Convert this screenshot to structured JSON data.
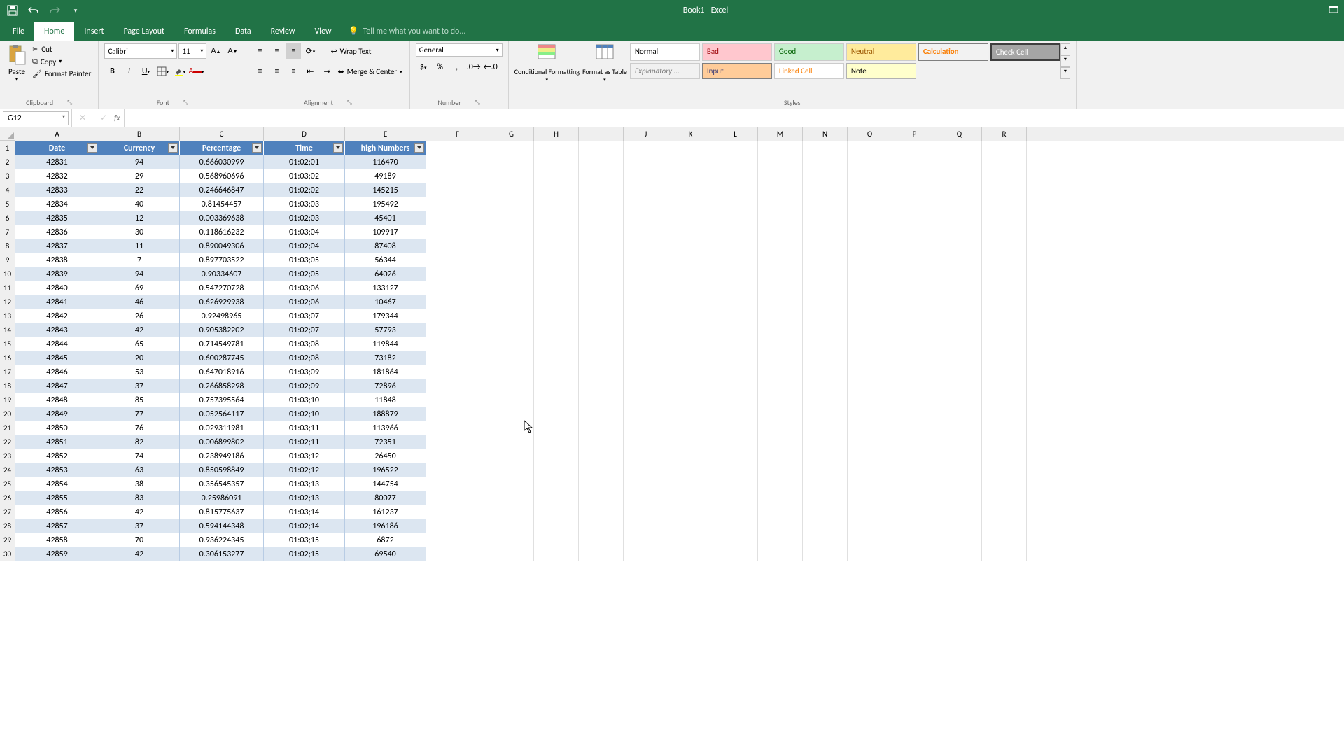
{
  "title": "Book1 - Excel",
  "qat": {
    "save": "save-icon",
    "undo": "undo-icon",
    "redo": "redo-icon"
  },
  "tabs": [
    "File",
    "Home",
    "Insert",
    "Page Layout",
    "Formulas",
    "Data",
    "Review",
    "View"
  ],
  "active_tab": 1,
  "tell_me": "Tell me what you want to do...",
  "ribbon": {
    "clipboard": {
      "label": "Clipboard",
      "paste": "Paste",
      "cut": "Cut",
      "copy": "Copy",
      "painter": "Format Painter"
    },
    "font": {
      "label": "Font",
      "name": "Calibri",
      "size": "11"
    },
    "alignment": {
      "label": "Alignment",
      "wrap": "Wrap Text",
      "merge": "Merge & Center"
    },
    "number": {
      "label": "Number",
      "format": "General"
    },
    "styles": {
      "label": "Styles",
      "cond": "Conditional Formatting",
      "table": "Format as Table",
      "gallery": [
        "Normal",
        "Bad",
        "Good",
        "Neutral",
        "Calculation",
        "Check Cell",
        "Explanatory ...",
        "Input",
        "Linked Cell",
        "Note"
      ]
    }
  },
  "name_box": "G12",
  "columns": [
    "A",
    "B",
    "C",
    "D",
    "E",
    "F",
    "G",
    "H",
    "I",
    "J",
    "K",
    "L",
    "M",
    "N",
    "O",
    "P",
    "Q",
    "R"
  ],
  "col_widths": [
    "cA",
    "cB",
    "cC",
    "cD",
    "cE",
    "cF",
    "cG",
    "cX",
    "cX",
    "cX",
    "cX",
    "cX",
    "cX",
    "cX",
    "cX",
    "cX",
    "cX",
    "cX"
  ],
  "table_headers": [
    "Date",
    "Currency",
    "Percentage",
    "Time",
    "high Numbers"
  ],
  "rows": [
    {
      "n": 2,
      "d": [
        42831,
        94,
        "0.666030999",
        "01:02;01",
        116470
      ]
    },
    {
      "n": 3,
      "d": [
        42832,
        29,
        "0.568960696",
        "01:03;02",
        49189
      ]
    },
    {
      "n": 4,
      "d": [
        42833,
        22,
        "0.246646847",
        "01:02;02",
        145215
      ]
    },
    {
      "n": 5,
      "d": [
        42834,
        40,
        "0.81454457",
        "01:03;03",
        195492
      ]
    },
    {
      "n": 6,
      "d": [
        42835,
        12,
        "0.003369638",
        "01:02;03",
        45401
      ]
    },
    {
      "n": 7,
      "d": [
        42836,
        30,
        "0.118616232",
        "01:03;04",
        109917
      ]
    },
    {
      "n": 8,
      "d": [
        42837,
        11,
        "0.890049306",
        "01:02;04",
        87408
      ]
    },
    {
      "n": 9,
      "d": [
        42838,
        7,
        "0.897703522",
        "01:03;05",
        56344
      ]
    },
    {
      "n": 10,
      "d": [
        42839,
        94,
        "0.90334607",
        "01:02;05",
        64026
      ]
    },
    {
      "n": 11,
      "d": [
        42840,
        69,
        "0.547270728",
        "01:03;06",
        133127
      ]
    },
    {
      "n": 12,
      "d": [
        42841,
        46,
        "0.626929938",
        "01:02;06",
        10467
      ]
    },
    {
      "n": 13,
      "d": [
        42842,
        26,
        "0.92498965",
        "01:03;07",
        179344
      ]
    },
    {
      "n": 14,
      "d": [
        42843,
        42,
        "0.905382202",
        "01:02;07",
        57793
      ]
    },
    {
      "n": 15,
      "d": [
        42844,
        65,
        "0.714549781",
        "01:03;08",
        119844
      ]
    },
    {
      "n": 16,
      "d": [
        42845,
        20,
        "0.600287745",
        "01:02;08",
        73182
      ]
    },
    {
      "n": 17,
      "d": [
        42846,
        53,
        "0.647018916",
        "01:03;09",
        181864
      ]
    },
    {
      "n": 18,
      "d": [
        42847,
        37,
        "0.266858298",
        "01:02;09",
        72896
      ]
    },
    {
      "n": 19,
      "d": [
        42848,
        85,
        "0.757395564",
        "01:03;10",
        11848
      ]
    },
    {
      "n": 20,
      "d": [
        42849,
        77,
        "0.052564117",
        "01:02;10",
        188879
      ]
    },
    {
      "n": 21,
      "d": [
        42850,
        76,
        "0.029311981",
        "01:03;11",
        113966
      ]
    },
    {
      "n": 22,
      "d": [
        42851,
        82,
        "0.006899802",
        "01:02;11",
        72351
      ]
    },
    {
      "n": 23,
      "d": [
        42852,
        74,
        "0.238949186",
        "01:03;12",
        26450
      ]
    },
    {
      "n": 24,
      "d": [
        42853,
        63,
        "0.850598849",
        "01:02;12",
        196522
      ]
    },
    {
      "n": 25,
      "d": [
        42854,
        38,
        "0.356545357",
        "01:03;13",
        144754
      ]
    },
    {
      "n": 26,
      "d": [
        42855,
        83,
        "0.25986091",
        "01:02;13",
        80077
      ]
    },
    {
      "n": 27,
      "d": [
        42856,
        42,
        "0.815775637",
        "01:03;14",
        161237
      ]
    },
    {
      "n": 28,
      "d": [
        42857,
        37,
        "0.594144348",
        "01:02;14",
        196186
      ]
    },
    {
      "n": 29,
      "d": [
        42858,
        70,
        "0.936224345",
        "01:03;15",
        6872
      ]
    },
    {
      "n": 30,
      "d": [
        42859,
        42,
        "0.306153277",
        "01:02;15",
        69540
      ]
    }
  ]
}
